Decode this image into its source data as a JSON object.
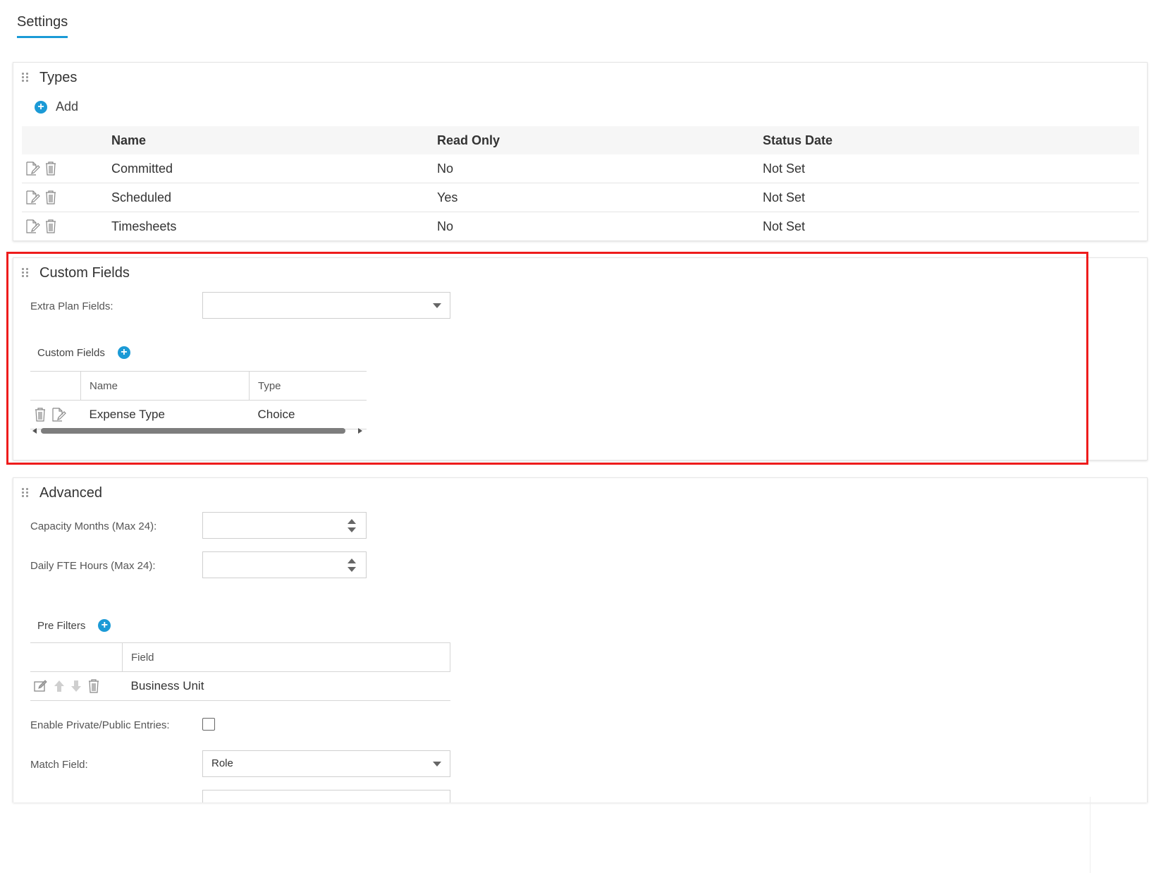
{
  "tab": {
    "label": "Settings"
  },
  "types": {
    "title": "Types",
    "add_label": "Add",
    "columns": [
      "Name",
      "Read Only",
      "Status Date"
    ],
    "rows": [
      {
        "name": "Committed",
        "read_only": "No",
        "status_date": "Not Set"
      },
      {
        "name": "Scheduled",
        "read_only": "Yes",
        "status_date": "Not Set"
      },
      {
        "name": "Timesheets",
        "read_only": "No",
        "status_date": "Not Set"
      }
    ]
  },
  "custom_fields": {
    "title": "Custom Fields",
    "extra_plan_label": "Extra Plan Fields:",
    "extra_plan_value": "",
    "subheading": "Custom Fields",
    "columns": [
      "Name",
      "Type"
    ],
    "rows": [
      {
        "name": "Expense Type",
        "type": "Choice"
      }
    ]
  },
  "advanced": {
    "title": "Advanced",
    "capacity_label": "Capacity Months (Max 24):",
    "capacity_value": "",
    "daily_fte_label": "Daily FTE Hours (Max 24):",
    "daily_fte_value": "",
    "pre_filters_heading": "Pre Filters",
    "pre_filters_column": "Field",
    "pre_filters_rows": [
      {
        "field": "Business Unit"
      }
    ],
    "enable_private_label": "Enable Private/Public Entries:",
    "enable_private_checked": false,
    "match_field_label": "Match Field:",
    "match_field_value": "Role"
  },
  "colors": {
    "accent": "#1b9ad6",
    "highlight": "#ee1c1c"
  },
  "icons": [
    "drag-handle-icon",
    "plus-circle-icon",
    "edit-icon",
    "trash-icon",
    "arrow-up-icon",
    "arrow-down-icon",
    "caret-down-icon"
  ]
}
